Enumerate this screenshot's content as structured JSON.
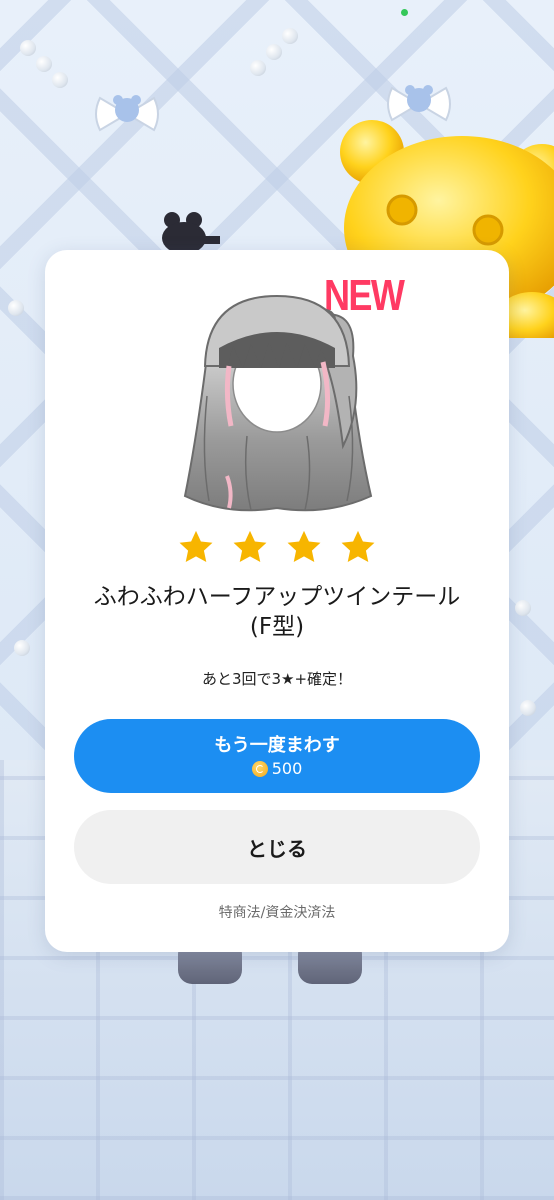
{
  "modal": {
    "badge": "NEW",
    "item_image_icon": "hair-half-up-twintail-icon",
    "rarity_stars": 4,
    "item_name": "ふわふわハーフアップツインテール\n(F型)",
    "guarantee_text": "あと3回で3★+確定！",
    "spin_again_button": {
      "label": "もう一度まわす",
      "cost_icon": "coin-icon",
      "cost": "500"
    },
    "close_button_label": "とじる",
    "legal_link": "特商法/資金決済法"
  },
  "colors": {
    "accent_blue": "#1c8ef2",
    "new_badge_red": "#ff3a63",
    "star_gold": "#f7b500",
    "close_button_bg": "#f0f0f0"
  }
}
